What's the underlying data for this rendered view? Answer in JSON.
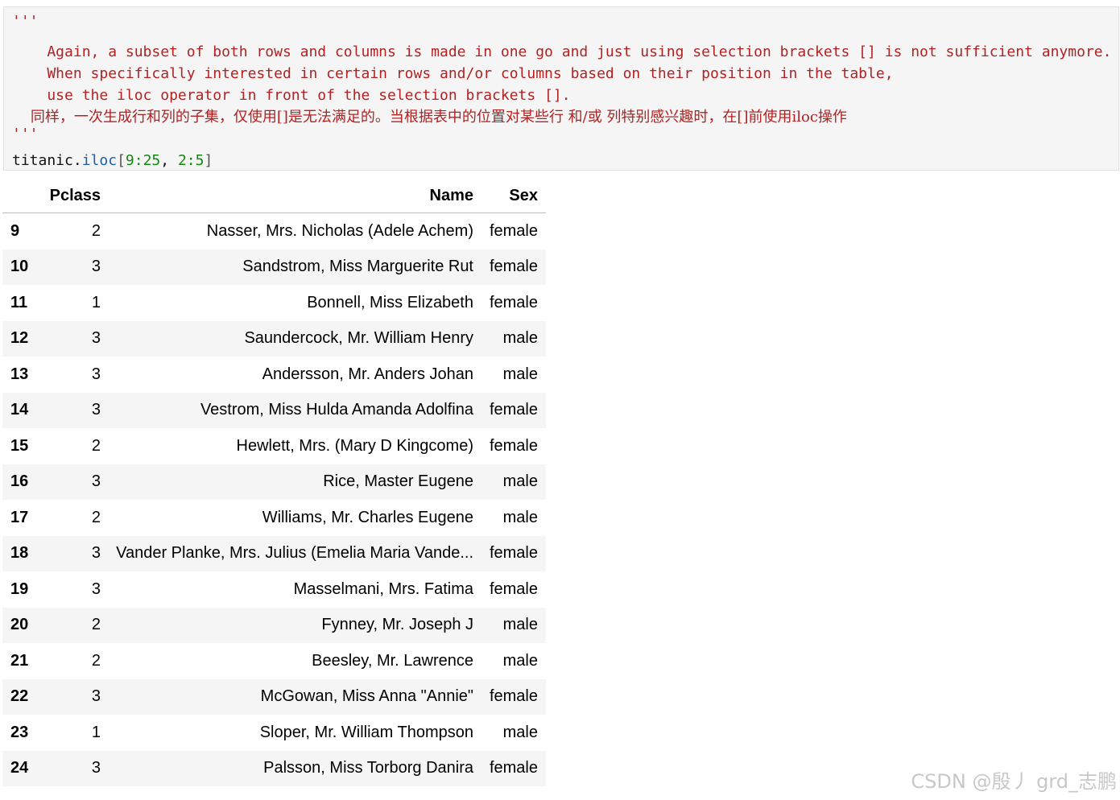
{
  "code_cell": {
    "docstring_open": "'''",
    "docstring_lines": [
      "    Again, a subset of both rows and columns is made in one go and just using selection brackets [] is not sufficient anymore.",
      "    When specifically interested in certain rows and/or columns based on their position in the table,",
      "    use the iloc operator in front of the selection brackets []."
    ],
    "docstring_cn": "    同样，一次生成行和列的子集，仅使用[]是无法满足的。当根据表中的位置对某些行 和/或 列特别感兴趣时，在[]前使用iloc操作",
    "docstring_close": "'''",
    "code": {
      "object": "titanic",
      "dot": ".",
      "method": "iloc",
      "open": "[",
      "row_slice": "9:25",
      "comma": ", ",
      "col_slice": "2:5",
      "close": "]"
    }
  },
  "table": {
    "columns": [
      "",
      "Pclass",
      "Name",
      "Sex"
    ],
    "rows": [
      {
        "index": "9",
        "pclass": "2",
        "name": "Nasser, Mrs. Nicholas (Adele Achem)",
        "sex": "female"
      },
      {
        "index": "10",
        "pclass": "3",
        "name": "Sandstrom, Miss Marguerite Rut",
        "sex": "female"
      },
      {
        "index": "11",
        "pclass": "1",
        "name": "Bonnell, Miss Elizabeth",
        "sex": "female"
      },
      {
        "index": "12",
        "pclass": "3",
        "name": "Saundercock, Mr. William Henry",
        "sex": "male"
      },
      {
        "index": "13",
        "pclass": "3",
        "name": "Andersson, Mr. Anders Johan",
        "sex": "male"
      },
      {
        "index": "14",
        "pclass": "3",
        "name": "Vestrom, Miss Hulda Amanda Adolfina",
        "sex": "female"
      },
      {
        "index": "15",
        "pclass": "2",
        "name": "Hewlett, Mrs. (Mary D Kingcome)",
        "sex": "female"
      },
      {
        "index": "16",
        "pclass": "3",
        "name": "Rice, Master Eugene",
        "sex": "male"
      },
      {
        "index": "17",
        "pclass": "2",
        "name": "Williams, Mr. Charles Eugene",
        "sex": "male"
      },
      {
        "index": "18",
        "pclass": "3",
        "name": "Vander Planke, Mrs. Julius (Emelia Maria Vande...",
        "sex": "female"
      },
      {
        "index": "19",
        "pclass": "3",
        "name": "Masselmani, Mrs. Fatima",
        "sex": "female"
      },
      {
        "index": "20",
        "pclass": "2",
        "name": "Fynney, Mr. Joseph J",
        "sex": "male"
      },
      {
        "index": "21",
        "pclass": "2",
        "name": "Beesley, Mr. Lawrence",
        "sex": "male"
      },
      {
        "index": "22",
        "pclass": "3",
        "name": "McGowan, Miss Anna \"Annie\"",
        "sex": "female"
      },
      {
        "index": "23",
        "pclass": "1",
        "name": "Sloper, Mr. William Thompson",
        "sex": "male"
      },
      {
        "index": "24",
        "pclass": "3",
        "name": "Palsson, Miss Torborg Danira",
        "sex": "female"
      }
    ]
  },
  "watermark": "CSDN @殷丿 grd_志鹏",
  "colors": {
    "string": "#b22222",
    "method": "#1a5fa8",
    "number": "#118811",
    "cell_background": "#f5f5f5",
    "stripe": "#f5f5f5"
  }
}
